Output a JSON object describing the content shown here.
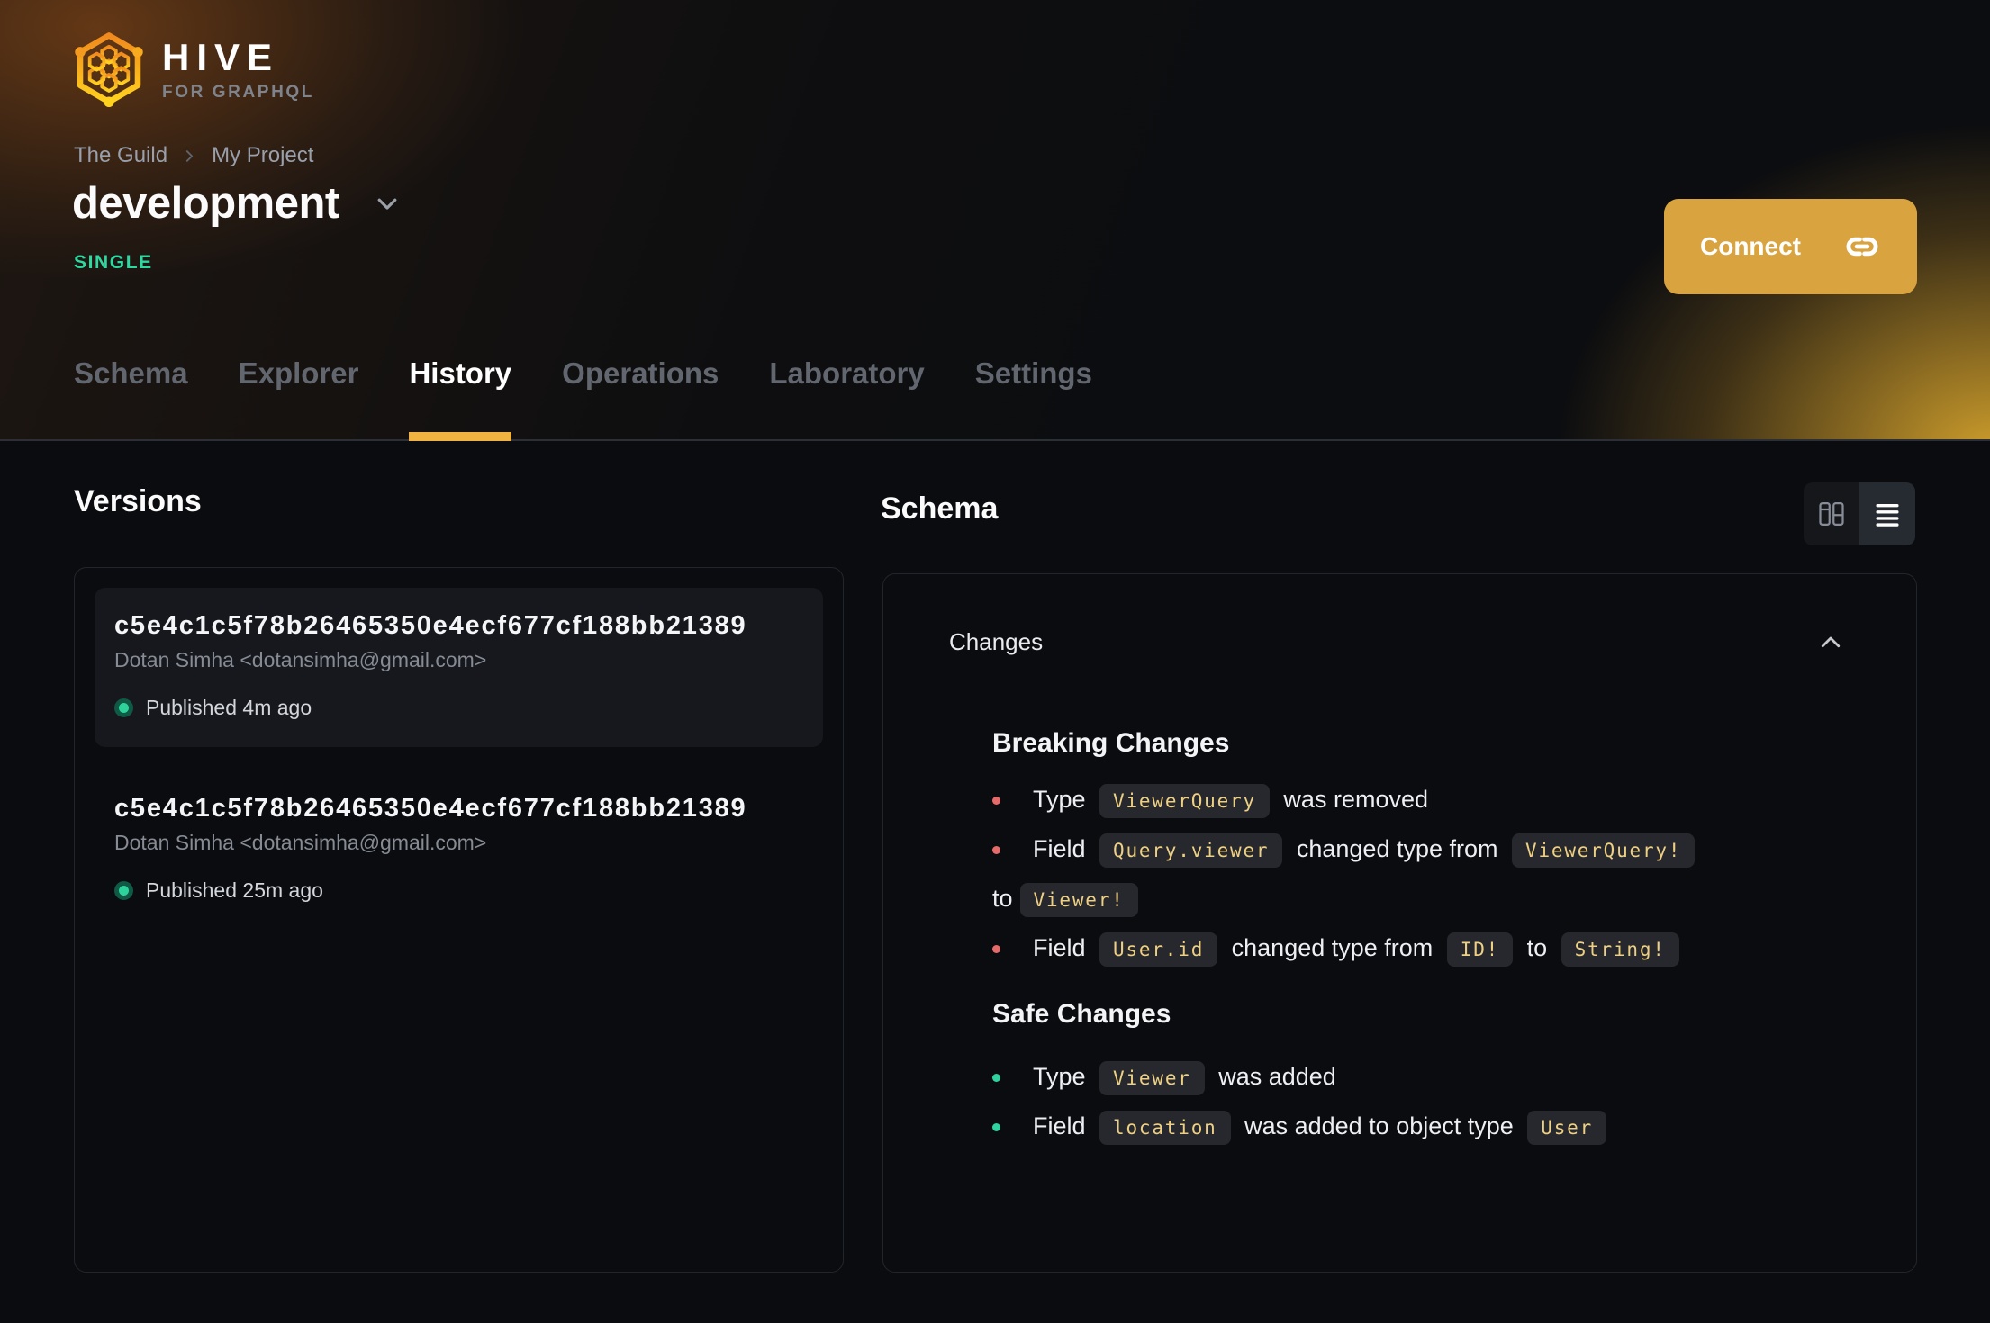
{
  "colors": {
    "accent": "#f0b342",
    "connect": "#d9a440",
    "green": "#2ed39b",
    "red": "#e56b6b",
    "safe-green": "#2fd3a0",
    "chip-text": "#eed084",
    "badge-green": "#2dd9a1"
  },
  "header": {
    "logo": {
      "title": "HIVE",
      "subtitle": "FOR GRAPHQL"
    },
    "breadcrumb": {
      "org": "The Guild",
      "project": "My Project"
    },
    "target": {
      "name": "development",
      "badge": "SINGLE"
    },
    "connect_label": "Connect",
    "tabs": [
      {
        "label": "Schema",
        "active": false
      },
      {
        "label": "Explorer",
        "active": false
      },
      {
        "label": "History",
        "active": true
      },
      {
        "label": "Operations",
        "active": false
      },
      {
        "label": "Laboratory",
        "active": false
      },
      {
        "label": "Settings",
        "active": false
      }
    ]
  },
  "versions_panel": {
    "title": "Versions",
    "items": [
      {
        "hash": "c5e4c1c5f78b26465350e4ecf677cf188bb21389",
        "author": "Dotan Simha <dotansimha@gmail.com>",
        "status": "Published 4m ago",
        "selected": true
      },
      {
        "hash": "c5e4c1c5f78b26465350e4ecf677cf188bb21389",
        "author": "Dotan Simha <dotansimha@gmail.com>",
        "status": "Published 25m ago",
        "selected": false
      }
    ]
  },
  "schema_panel": {
    "title": "Schema",
    "section_title": "Changes",
    "groups": [
      {
        "title": "Breaking Changes",
        "items": [
          {
            "s0": "Type ",
            "c0": "ViewerQuery",
            "s1": " was removed"
          },
          {
            "s0": "Field ",
            "c0": "Query.viewer",
            "s1": " changed type from ",
            "c1": "ViewerQuery!",
            "s2": "to",
            "c2": "Viewer!"
          },
          {
            "s0": "Field ",
            "c0": "User.id",
            "s1": " changed type from ",
            "c1": "ID!",
            "s2": " to ",
            "c2": "String!"
          }
        ]
      },
      {
        "title": "Safe Changes",
        "items": [
          {
            "s0": "Type ",
            "c0": "Viewer",
            "s1": " was added"
          },
          {
            "s0": "Field ",
            "c0": "location",
            "s1": " was added to object type ",
            "c1": "User"
          }
        ]
      }
    ]
  }
}
